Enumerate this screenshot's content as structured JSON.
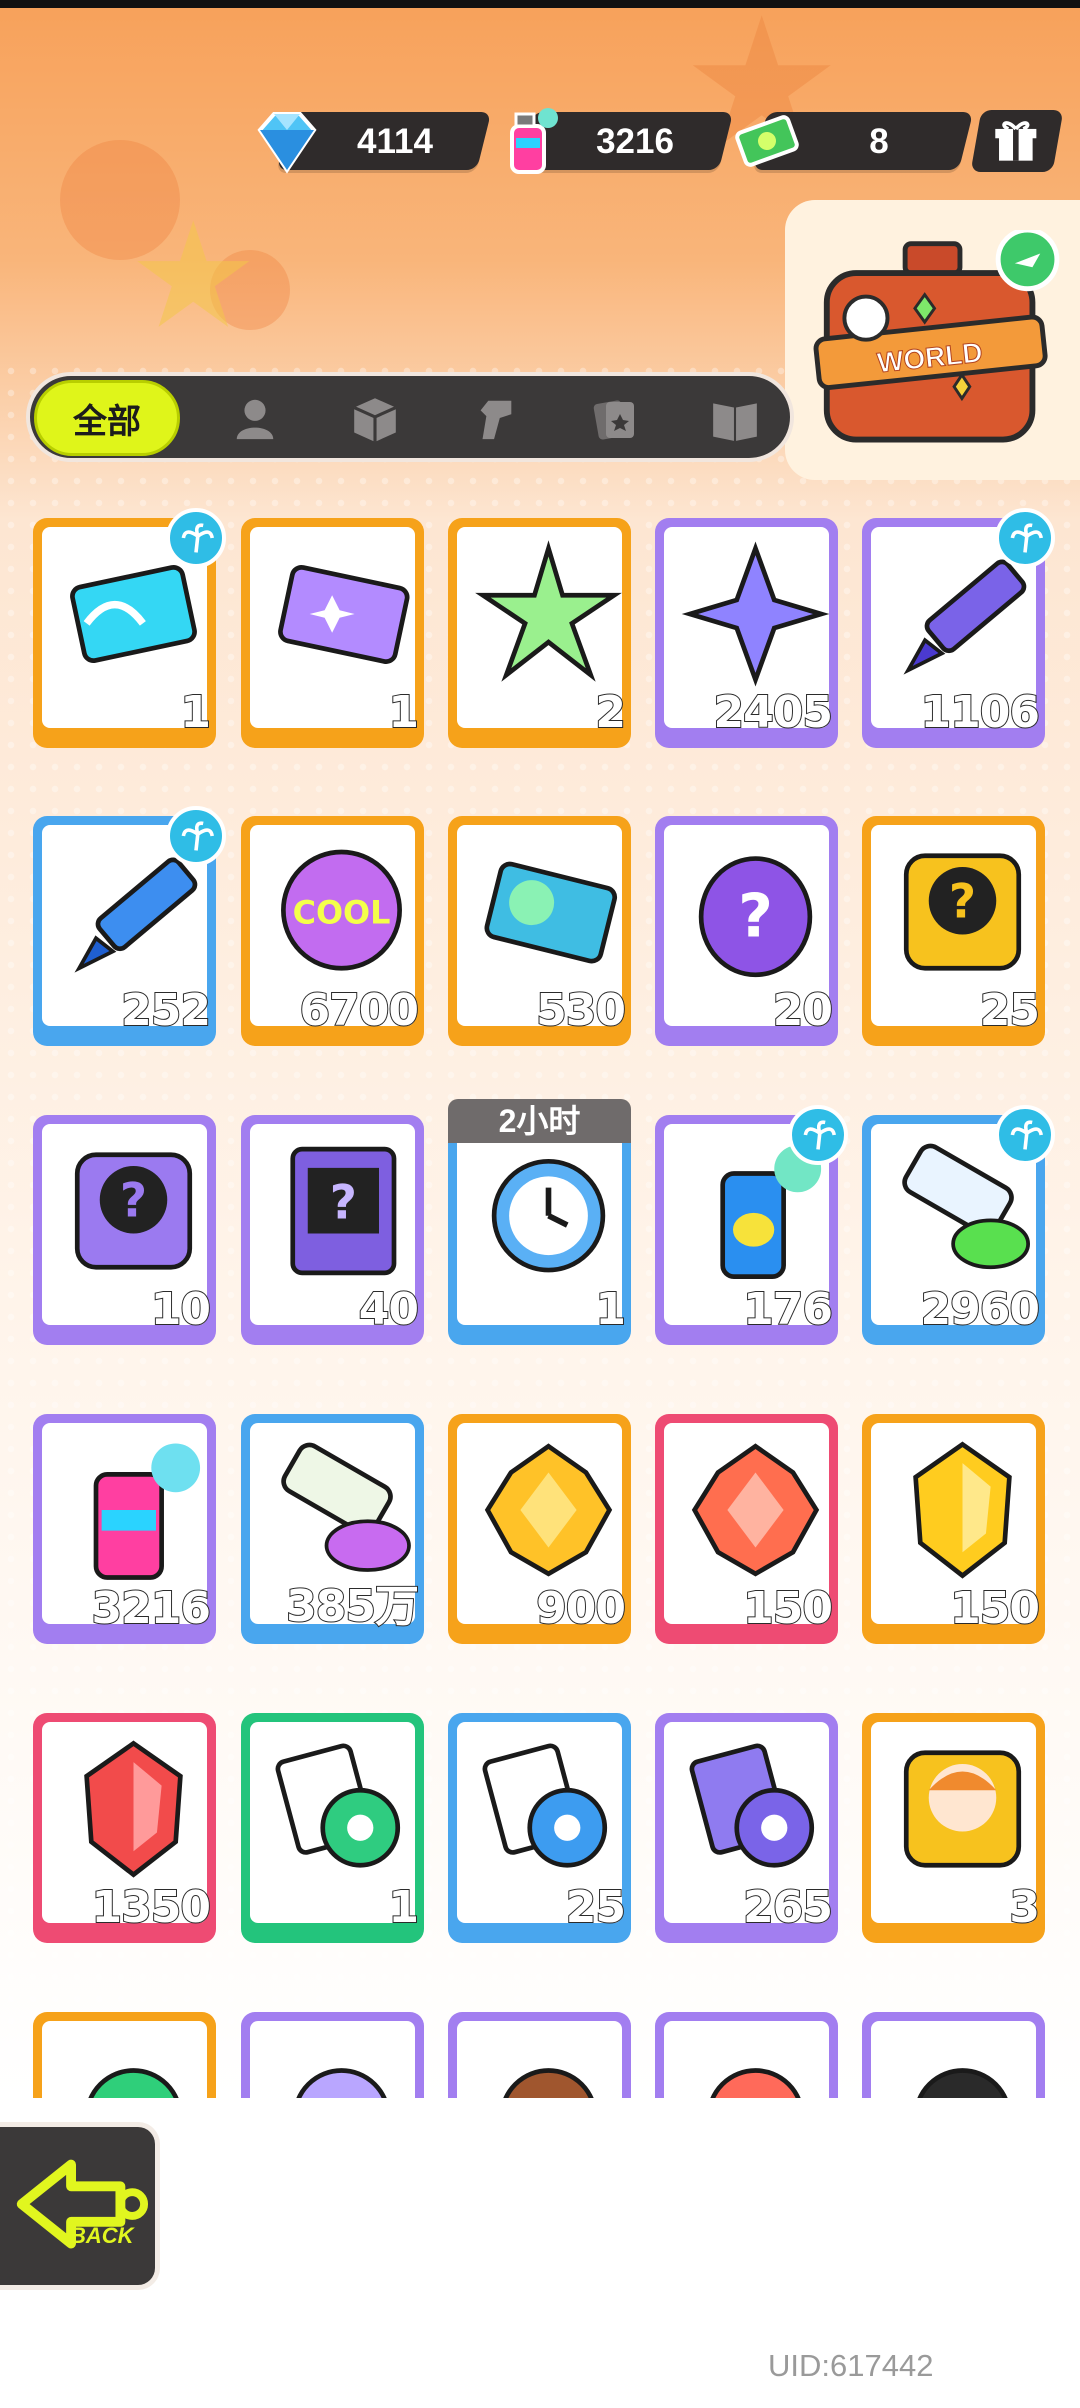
{
  "currencies": [
    {
      "icon": "diamond-icon",
      "value": "4114"
    },
    {
      "icon": "spray-can-icon",
      "value": "3216"
    },
    {
      "icon": "cash-icon",
      "value": "8"
    }
  ],
  "gift_button": {
    "icon": "gift-box-icon"
  },
  "suitcase": {
    "label": "WORLD",
    "icon": "suitcase-icon"
  },
  "tabs": [
    {
      "label": "全部",
      "icon": ""
    },
    {
      "label": "",
      "icon": "person-icon"
    },
    {
      "label": "",
      "icon": "box-icon"
    },
    {
      "label": "",
      "icon": "spray-gun-icon"
    },
    {
      "label": "",
      "icon": "card-icon"
    },
    {
      "label": "",
      "icon": "book-icon"
    }
  ],
  "items": [
    {
      "icon": "wave-ticket-icon",
      "count": "1",
      "color": "orange",
      "badge": true,
      "timer": ""
    },
    {
      "icon": "deity-ticket-icon",
      "count": "1",
      "color": "orange",
      "badge": false,
      "timer": ""
    },
    {
      "icon": "rainbow-star-icon",
      "count": "2",
      "color": "orange",
      "badge": false,
      "timer": ""
    },
    {
      "icon": "purple-star-icon",
      "count": "2405",
      "color": "purple",
      "badge": false,
      "timer": ""
    },
    {
      "icon": "purple-crayon-icon",
      "count": "1106",
      "color": "purple",
      "badge": true,
      "timer": ""
    },
    {
      "icon": "blue-crayon-icon",
      "count": "252",
      "color": "blue",
      "badge": true,
      "timer": ""
    },
    {
      "icon": "cool-sticker-icon",
      "count": "6700",
      "color": "orange",
      "badge": false,
      "timer": ""
    },
    {
      "icon": "season-ticket-icon",
      "count": "530",
      "color": "orange",
      "badge": false,
      "timer": ""
    },
    {
      "icon": "mystery-egg-icon",
      "count": "20",
      "color": "purple",
      "badge": false,
      "timer": ""
    },
    {
      "icon": "gold-deity-puzzle-icon",
      "count": "25",
      "color": "orange",
      "badge": false,
      "timer": ""
    },
    {
      "icon": "purple-deity-puzzle-icon",
      "count": "10",
      "color": "purple",
      "badge": false,
      "timer": ""
    },
    {
      "icon": "travel-card-puzzle-icon",
      "count": "40",
      "color": "purple",
      "badge": false,
      "timer": ""
    },
    {
      "icon": "alarm-clock-icon",
      "count": "1",
      "color": "blue",
      "badge": false,
      "timer": "2小时"
    },
    {
      "icon": "blue-spray-can-icon",
      "count": "176",
      "color": "purple",
      "badge": true,
      "timer": ""
    },
    {
      "icon": "paint-tube-icon",
      "count": "2960",
      "color": "blue",
      "badge": true,
      "timer": ""
    },
    {
      "icon": "pink-spray-can-icon",
      "count": "3216",
      "color": "purple",
      "badge": false,
      "timer": ""
    },
    {
      "icon": "rainbow-paint-tube-icon",
      "count": "385万",
      "color": "blue",
      "badge": false,
      "timer": ""
    },
    {
      "icon": "gold-gem-icon",
      "count": "900",
      "color": "orange",
      "badge": false,
      "timer": ""
    },
    {
      "icon": "red-gem-icon",
      "count": "150",
      "color": "pink",
      "badge": false,
      "timer": ""
    },
    {
      "icon": "yellow-crystal-icon",
      "count": "150",
      "color": "orange",
      "badge": false,
      "timer": ""
    },
    {
      "icon": "red-crystal-icon",
      "count": "1350",
      "color": "pink",
      "badge": false,
      "timer": ""
    },
    {
      "icon": "green-tape-icon",
      "count": "1",
      "color": "green",
      "badge": false,
      "timer": ""
    },
    {
      "icon": "blue-tape-icon",
      "count": "25",
      "color": "blue",
      "badge": false,
      "timer": ""
    },
    {
      "icon": "purple-tape-icon",
      "count": "265",
      "color": "purple",
      "badge": false,
      "timer": ""
    },
    {
      "icon": "deity-avatar-icon",
      "count": "3",
      "color": "orange",
      "badge": false,
      "timer": ""
    },
    {
      "icon": "green-hair-avatar-icon",
      "count": "",
      "color": "orange",
      "badge": false,
      "timer": ""
    },
    {
      "icon": "lavender-hair-avatar-icon",
      "count": "",
      "color": "purple",
      "badge": false,
      "timer": ""
    },
    {
      "icon": "brown-hair-avatar-icon",
      "count": "",
      "color": "purple",
      "badge": false,
      "timer": ""
    },
    {
      "icon": "red-hair-avatar-icon",
      "count": "",
      "color": "purple",
      "badge": false,
      "timer": ""
    },
    {
      "icon": "green-visor-avatar-icon",
      "count": "",
      "color": "purple",
      "badge": false,
      "timer": ""
    }
  ],
  "colors": {
    "orange": "#f6a21a",
    "purple": "#a27ef0",
    "blue": "#49a6ee",
    "pink": "#ee4b73",
    "green": "#23c47c",
    "tab_active": "#dff51a",
    "dark": "#3b3939"
  },
  "back_button": {
    "label": "BACK",
    "icon": "back-arrow-icon"
  },
  "uid": "UID:617442"
}
